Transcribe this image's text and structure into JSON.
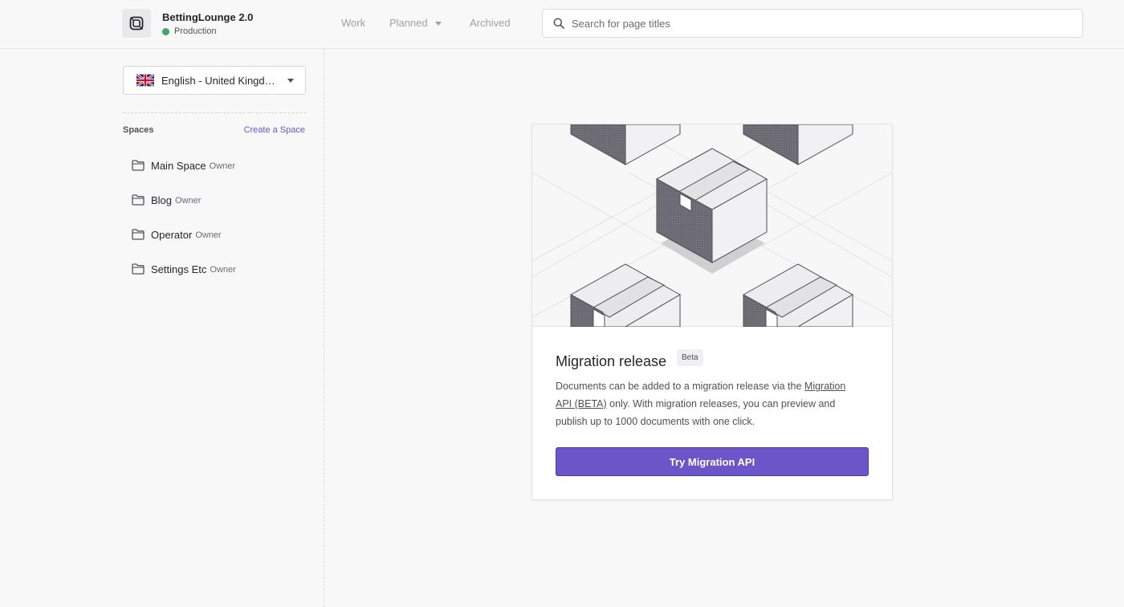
{
  "header": {
    "repo_name": "BettingLounge 2.0",
    "environment": "Production",
    "nav": {
      "work": "Work",
      "planned": "Planned",
      "archived": "Archived"
    },
    "search_placeholder": "Search for page titles"
  },
  "sidebar": {
    "locale": "English - United Kingdom",
    "spaces_title": "Spaces",
    "create_space": "Create a Space",
    "spaces": [
      {
        "name": "Main Space",
        "role": "Owner"
      },
      {
        "name": "Blog",
        "role": "Owner"
      },
      {
        "name": "Operator",
        "role": "Owner"
      },
      {
        "name": "Settings Etc",
        "role": "Owner"
      }
    ]
  },
  "card": {
    "title": "Migration release",
    "badge": "Beta",
    "desc_pre": "Documents can be added to a migration release via the ",
    "desc_link": "Migration API (BETA)",
    "desc_post": " only. With migration releases, you can preview and publish up to 1000 documents with one click.",
    "cta": "Try Migration API"
  },
  "colors": {
    "accent": "#6b55c8",
    "status_green": "#3aa862"
  },
  "icons": [
    "repo-logo-icon",
    "status-dot-icon",
    "chevron-down-icon",
    "search-icon",
    "uk-flag-icon",
    "folder-icon",
    "boxes-illustration"
  ]
}
